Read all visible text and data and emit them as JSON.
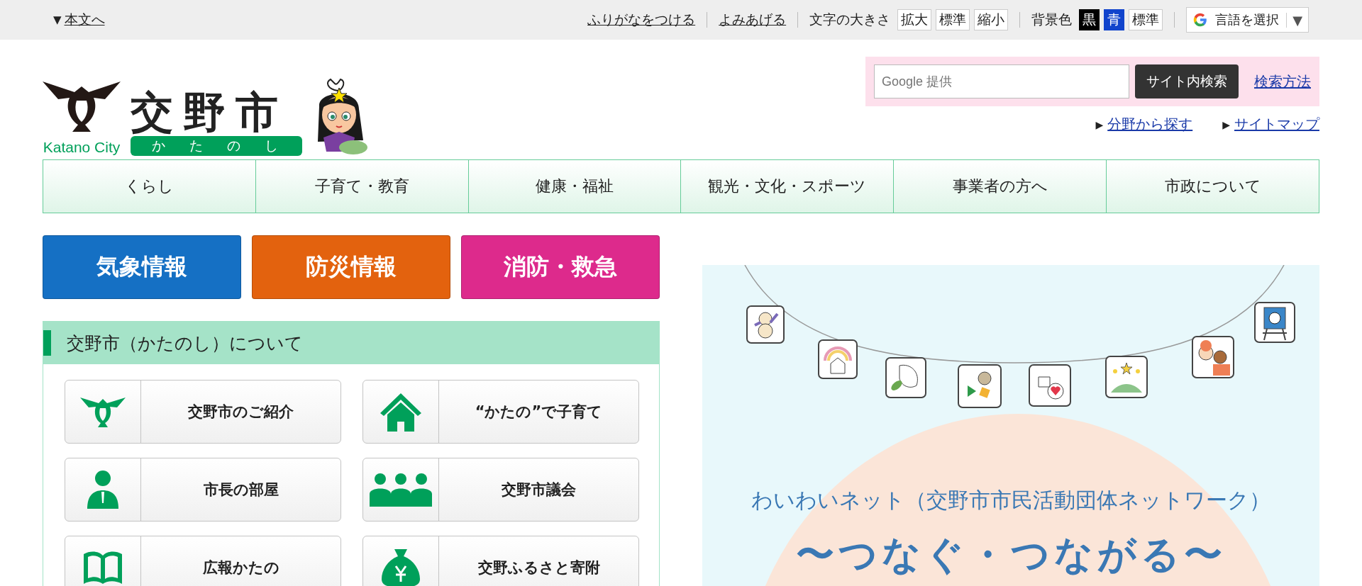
{
  "top_bar": {
    "skip_link": {
      "marker": "▼",
      "label": "本文へ"
    },
    "links": [
      "ふりがなをつける",
      "よみあげる"
    ],
    "font_size": {
      "label": "文字の大きさ",
      "buttons": [
        "拡大",
        "標準",
        "縮小"
      ]
    },
    "background_color": {
      "label": "背景色",
      "options": [
        {
          "label": "黒",
          "kind": "black"
        },
        {
          "label": "青",
          "kind": "blue"
        },
        {
          "label": "標準",
          "kind": "standard"
        }
      ]
    },
    "language": {
      "label": "言語を選択",
      "caret": "▼"
    }
  },
  "header": {
    "logo": {
      "title": "交野市",
      "english": "Katano City",
      "reading": "かたのし"
    },
    "search": {
      "placeholder": "Google 提供",
      "button": "サイト内検索",
      "help_link": "検索方法"
    },
    "links": [
      {
        "marker": "▶",
        "label": "分野から探す"
      },
      {
        "marker": "▶",
        "label": "サイトマップ"
      }
    ]
  },
  "nav": {
    "items": [
      "くらし",
      "子育て・教育",
      "健康・福祉",
      "観光・文化・スポーツ",
      "事業者の方へ",
      "市政について"
    ]
  },
  "emergency_buttons": [
    {
      "label": "気象情報",
      "color": "#1570c4"
    },
    {
      "label": "防災情報",
      "color": "#e3620e"
    },
    {
      "label": "消防・救急",
      "color": "#dd2a8c"
    }
  ],
  "about": {
    "title": "交野市（かたのし）について",
    "cards": [
      {
        "label": "交野市のご紹介",
        "kind": "crest"
      },
      {
        "label": "“かたの”で子育て",
        "kind": "house"
      },
      {
        "label": "市長の部屋",
        "kind": "person"
      },
      {
        "label": "交野市議会",
        "kind": "group"
      },
      {
        "label": "広報かたの",
        "kind": "book"
      },
      {
        "label": "交野ふるさと寄附",
        "kind": "moneybag"
      }
    ]
  },
  "banner": {
    "subtitle": "わいわいネット（交野市市民活動団体ネットワーク）",
    "title": "〜つなぐ・つながる〜"
  }
}
